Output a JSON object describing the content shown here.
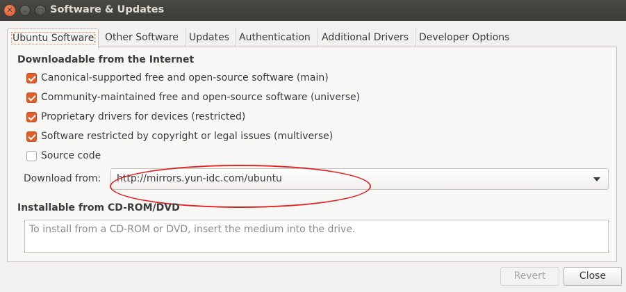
{
  "window": {
    "title": "Software & Updates",
    "close_glyph": "✕",
    "minimize_glyph": "–",
    "maximize_glyph": "□"
  },
  "tabs": [
    {
      "label": "Ubuntu Software",
      "active": true
    },
    {
      "label": "Other Software",
      "active": false
    },
    {
      "label": "Updates",
      "active": false
    },
    {
      "label": "Authentication",
      "active": false
    },
    {
      "label": "Additional Drivers",
      "active": false
    },
    {
      "label": "Developer Options",
      "active": false
    }
  ],
  "downloadable": {
    "title": "Downloadable from the Internet",
    "items": [
      {
        "label": "Canonical-supported free and open-source software (main)",
        "checked": true
      },
      {
        "label": "Community-maintained free and open-source software (universe)",
        "checked": true
      },
      {
        "label": "Proprietary drivers for devices (restricted)",
        "checked": true
      },
      {
        "label": "Software restricted by copyright or legal issues (multiverse)",
        "checked": true
      },
      {
        "label": "Source code",
        "checked": false
      }
    ],
    "download_from_label": "Download from:",
    "download_from_value": "http://mirrors.yun-idc.com/ubuntu"
  },
  "cdrom": {
    "title": "Installable from CD-ROM/DVD",
    "placeholder": "To install from a CD-ROM or DVD, insert the medium into the drive."
  },
  "buttons": {
    "revert": "Revert",
    "close": "Close"
  },
  "colors": {
    "accent": "#e05e2a",
    "annotation": "#e02424",
    "titlebar": "#3c3b37"
  }
}
